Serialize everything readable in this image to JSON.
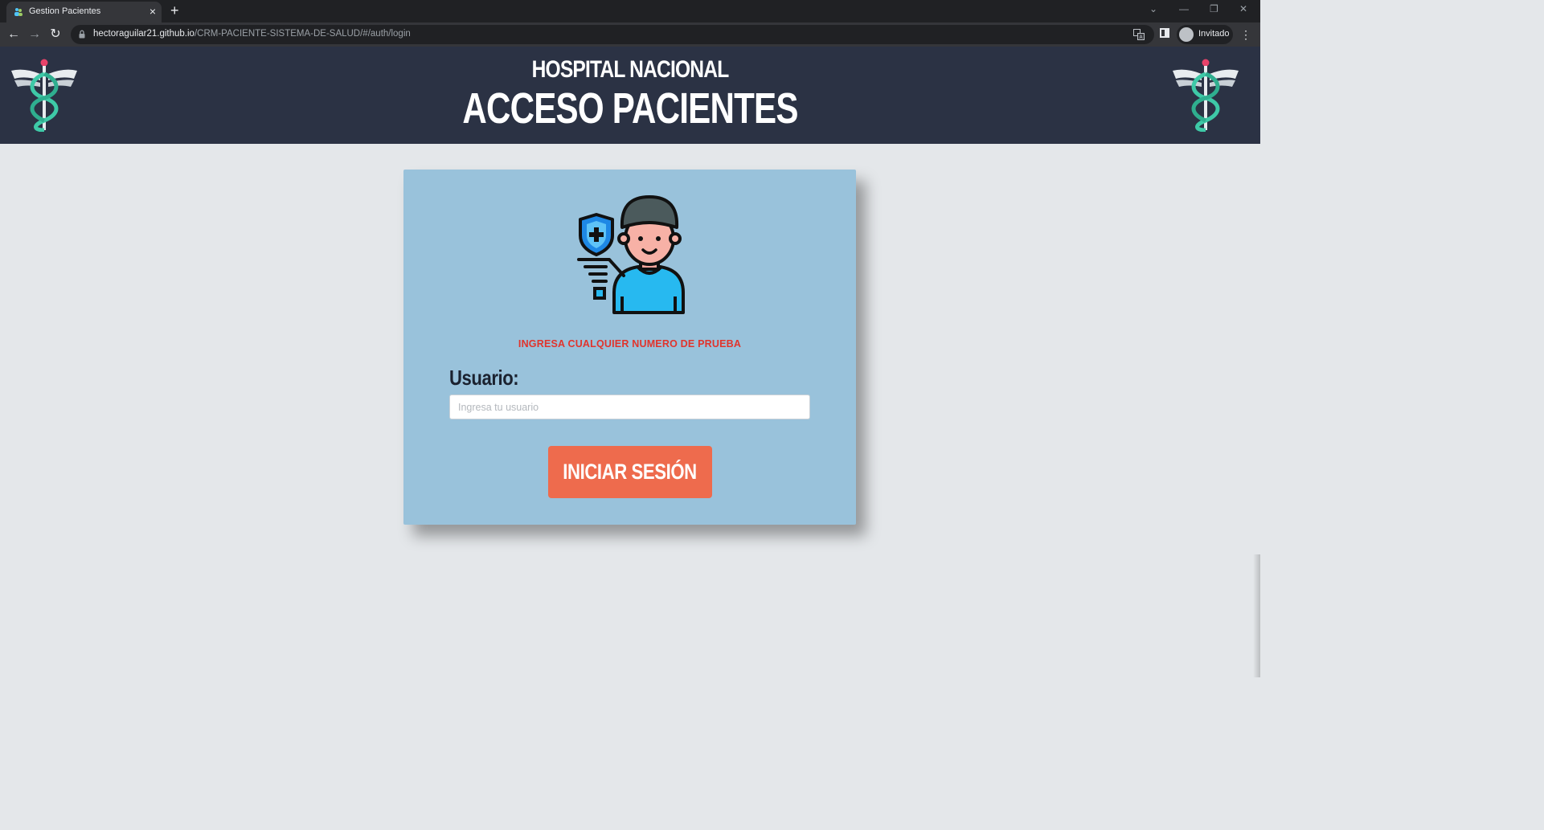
{
  "browser": {
    "tab_title": "Gestion Pacientes",
    "tab_close": "×",
    "new_tab": "+",
    "url_host": "hectoraguilar21.github.io",
    "url_path": "/CRM-PACIENTE-SISTEMA-DE-SALUD/#/auth/login",
    "profile_label": "Invitado",
    "back": "←",
    "forward": "→",
    "reload": "↻",
    "menu": "⋮",
    "minimize": "—",
    "restore": "❐",
    "close": "✕",
    "tab_search": "⌄"
  },
  "header": {
    "subtitle": "HOSPITAL NACIONAL",
    "title": "ACCESO PACIENTES"
  },
  "login": {
    "hint": "INGRESA CUALQUIER NUMERO DE PRUEBA",
    "user_label": "Usuario:",
    "user_placeholder": "Ingresa tu usuario",
    "user_value": "",
    "submit_label": "INICIAR SESIÓN"
  },
  "colors": {
    "header_bg": "#2b3244",
    "card_bg": "#99c2db",
    "button_bg": "#ee6b4d",
    "hint_color": "#e1342c",
    "page_bg": "#e4e7ea"
  }
}
